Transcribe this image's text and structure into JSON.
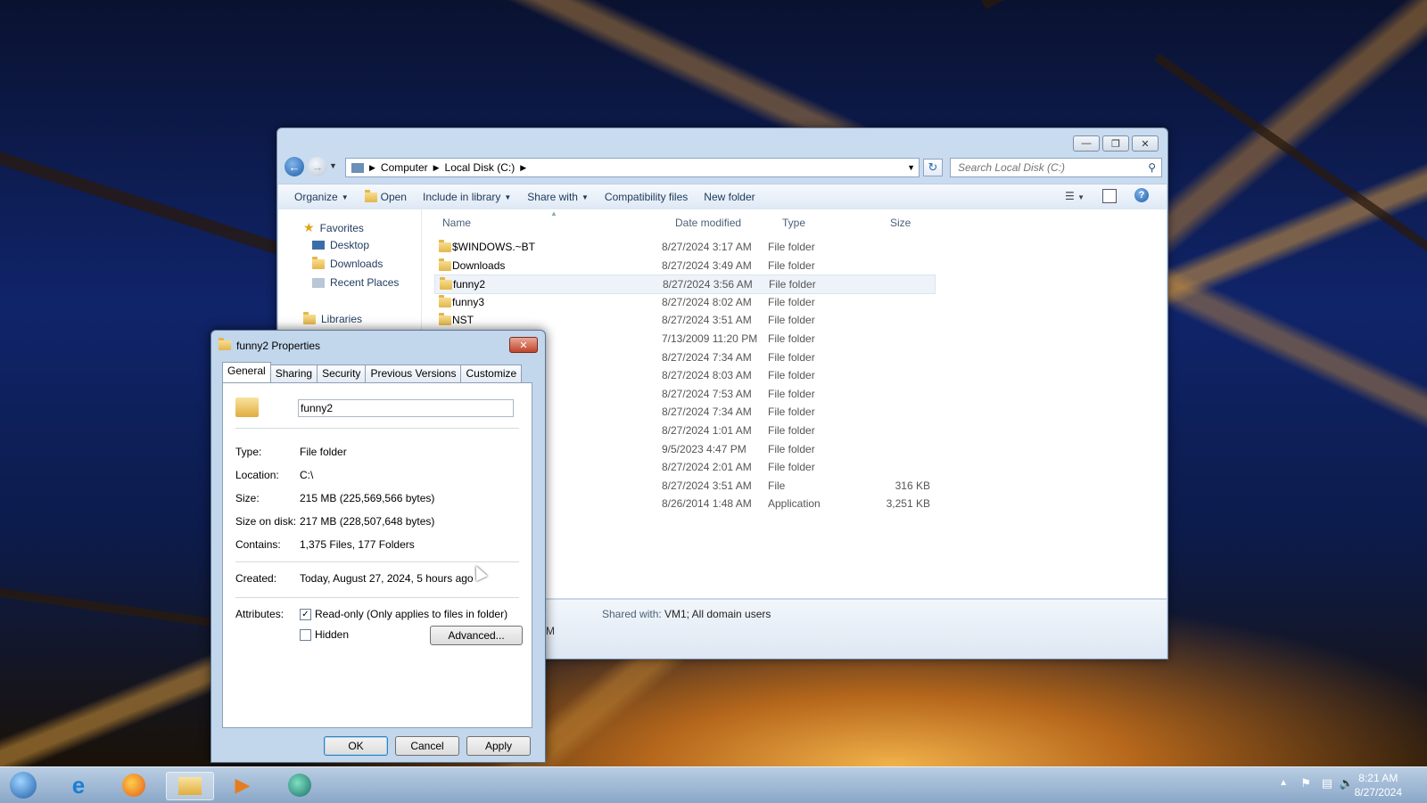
{
  "explorer": {
    "breadcrumb": [
      "Computer",
      "Local Disk (C:)"
    ],
    "search_placeholder": "Search Local Disk (C:)",
    "toolbar": {
      "organize": "Organize",
      "open": "Open",
      "include_in_library": "Include in library",
      "share_with": "Share with",
      "compatibility_files": "Compatibility files",
      "new_folder": "New folder"
    },
    "nav": {
      "favorites": "Favorites",
      "desktop": "Desktop",
      "downloads": "Downloads",
      "recent_places": "Recent Places",
      "libraries": "Libraries"
    },
    "columns": {
      "name": "Name",
      "date_modified": "Date modified",
      "type": "Type",
      "size": "Size"
    },
    "rows": [
      {
        "name": "$WINDOWS.~BT",
        "date": "8/27/2024 3:17 AM",
        "type": "File folder",
        "size": ""
      },
      {
        "name": "Downloads",
        "date": "8/27/2024 3:49 AM",
        "type": "File folder",
        "size": ""
      },
      {
        "name": "funny2",
        "date": "8/27/2024 3:56 AM",
        "type": "File folder",
        "size": ""
      },
      {
        "name": "funny3",
        "date": "8/27/2024 8:02 AM",
        "type": "File folder",
        "size": ""
      },
      {
        "name": "NST",
        "date": "8/27/2024 3:51 AM",
        "type": "File folder",
        "size": ""
      },
      {
        "name": "",
        "date": "7/13/2009 11:20 PM",
        "type": "File folder",
        "size": ""
      },
      {
        "name": "",
        "date": "8/27/2024 7:34 AM",
        "type": "File folder",
        "size": ""
      },
      {
        "name": "",
        "date": "8/27/2024 8:03 AM",
        "type": "File folder",
        "size": ""
      },
      {
        "name": "",
        "date": "8/27/2024 7:53 AM",
        "type": "File folder",
        "size": ""
      },
      {
        "name": "",
        "date": "8/27/2024 7:34 AM",
        "type": "File folder",
        "size": ""
      },
      {
        "name": "",
        "date": "8/27/2024 1:01 AM",
        "type": "File folder",
        "size": ""
      },
      {
        "name": "",
        "date": "9/5/2023 4:47 PM",
        "type": "File folder",
        "size": ""
      },
      {
        "name": "",
        "date": "8/27/2024 2:01 AM",
        "type": "File folder",
        "size": ""
      },
      {
        "name": "",
        "date": "8/27/2024 3:51 AM",
        "type": "File",
        "size": "316 KB"
      },
      {
        "name": "",
        "date": "8/26/2014 1:48 AM",
        "type": "Application",
        "size": "3,251 KB"
      }
    ],
    "details": {
      "shared_label": "Shared with:",
      "shared_value": "VM1; All domain users",
      "partial_text": "AM"
    }
  },
  "dialog": {
    "title": "funny2 Properties",
    "tabs": [
      "General",
      "Sharing",
      "Security",
      "Previous Versions",
      "Customize"
    ],
    "name_value": "funny2",
    "type_label": "Type:",
    "type_value": "File folder",
    "location_label": "Location:",
    "location_value": "C:\\",
    "size_label": "Size:",
    "size_value": "215 MB (225,569,566 bytes)",
    "size_on_disk_label": "Size on disk:",
    "size_on_disk_value": "217 MB (228,507,648 bytes)",
    "contains_label": "Contains:",
    "contains_value": "1,375 Files, 177 Folders",
    "created_label": "Created:",
    "created_value": "Today, August 27, 2024, 5 hours ago",
    "attributes_label": "Attributes:",
    "readonly_label": "Read-only (Only applies to files in folder)",
    "readonly_checked": true,
    "hidden_label": "Hidden",
    "hidden_checked": false,
    "advanced_button": "Advanced...",
    "ok_button": "OK",
    "cancel_button": "Cancel",
    "apply_button": "Apply"
  },
  "taskbar": {
    "time": "8:21 AM",
    "date": "8/27/2024"
  }
}
